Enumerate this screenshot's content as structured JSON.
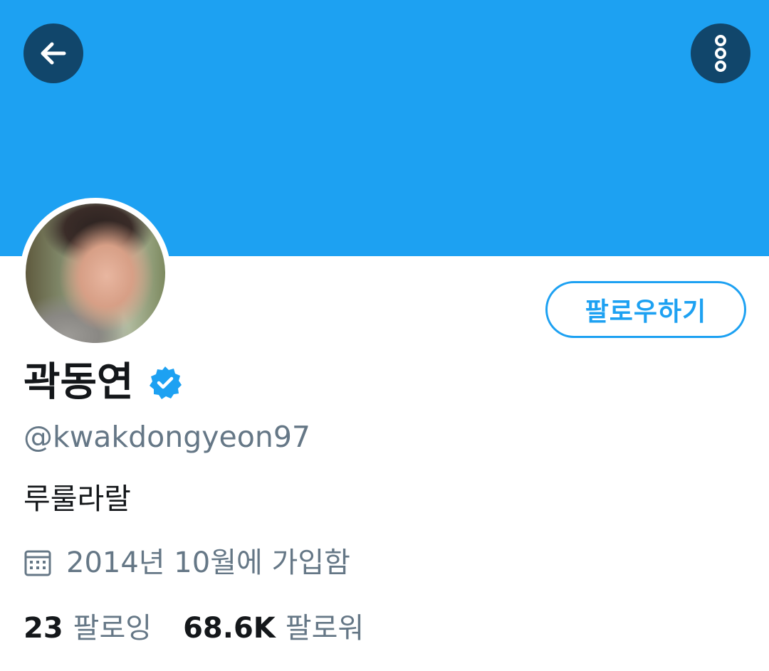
{
  "header": {
    "back_icon": "arrow-left-icon",
    "more_icon": "more-vertical-icon",
    "banner_color": "#1da1f2"
  },
  "profile": {
    "display_name": "곽동연",
    "verified": true,
    "handle": "@kwakdongyeon97",
    "bio": "루룰라랄",
    "joined": "2014년 10월에 가입함",
    "follow_button_label": "팔로우하기"
  },
  "stats": {
    "following_count": "23",
    "following_label": "팔로잉",
    "followers_count": "68.6K",
    "followers_label": "팔로워"
  },
  "colors": {
    "accent": "#1da1f2",
    "secondary_text": "#657786",
    "primary_text": "#14171a",
    "overlay_button": "#11466b"
  }
}
